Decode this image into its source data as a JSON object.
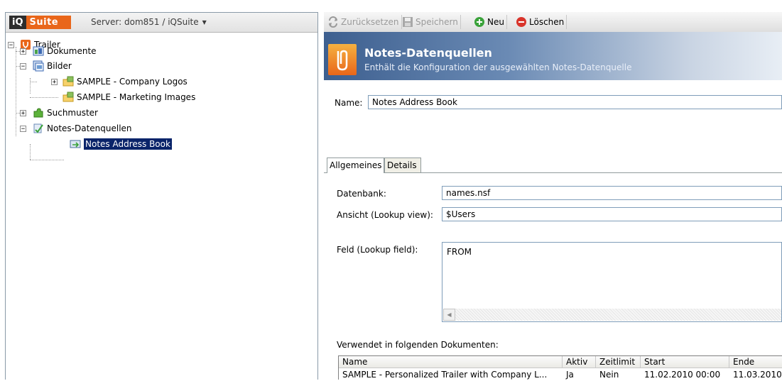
{
  "brand": {
    "iq": "iQ",
    "suite": "Suite"
  },
  "server": {
    "label": "Server: dom851 / iQSuite"
  },
  "tree": {
    "root": "Trailer",
    "dokumente": "Dokumente",
    "bilder": "Bilder",
    "company_logos": "SAMPLE - Company Logos",
    "marketing_images": "SAMPLE - Marketing Images",
    "suchmuster": "Suchmuster",
    "datenquellen": "Notes-Datenquellen",
    "address_book": "Notes Address Book"
  },
  "toolbar": {
    "reset": "Zurücksetzen",
    "save": "Speichern",
    "new": "Neu",
    "delete": "Löschen"
  },
  "banner": {
    "title": "Notes-Datenquellen",
    "subtitle": "Enthält die Konfiguration der ausgewählten Notes-Datenquelle"
  },
  "form": {
    "name_label": "Name:",
    "name_value": "Notes Address Book",
    "tabs": [
      "Allgemeines",
      "Details"
    ],
    "db_label": "Datenbank:",
    "db_value": "names.nsf",
    "view_label": "Ansicht (Lookup view):",
    "view_value": "$Users",
    "field_label": "Feld (Lookup field):",
    "field_value": "FROM",
    "used_in_label": "Verwendet in folgenden Dokumenten:"
  },
  "docs_table": {
    "columns": [
      "Name",
      "Aktiv",
      "Zeitlimit",
      "Start",
      "Ende"
    ],
    "rows": [
      [
        "SAMPLE - Personalized Trailer with Company L...",
        "Ja",
        "Nein",
        "11.02.2010 00:00",
        "11.03.2010"
      ]
    ]
  },
  "colors": {
    "selection": "#0a246a",
    "brand_orange": "#e9661a",
    "banner_blue": "#3d5f8f"
  }
}
